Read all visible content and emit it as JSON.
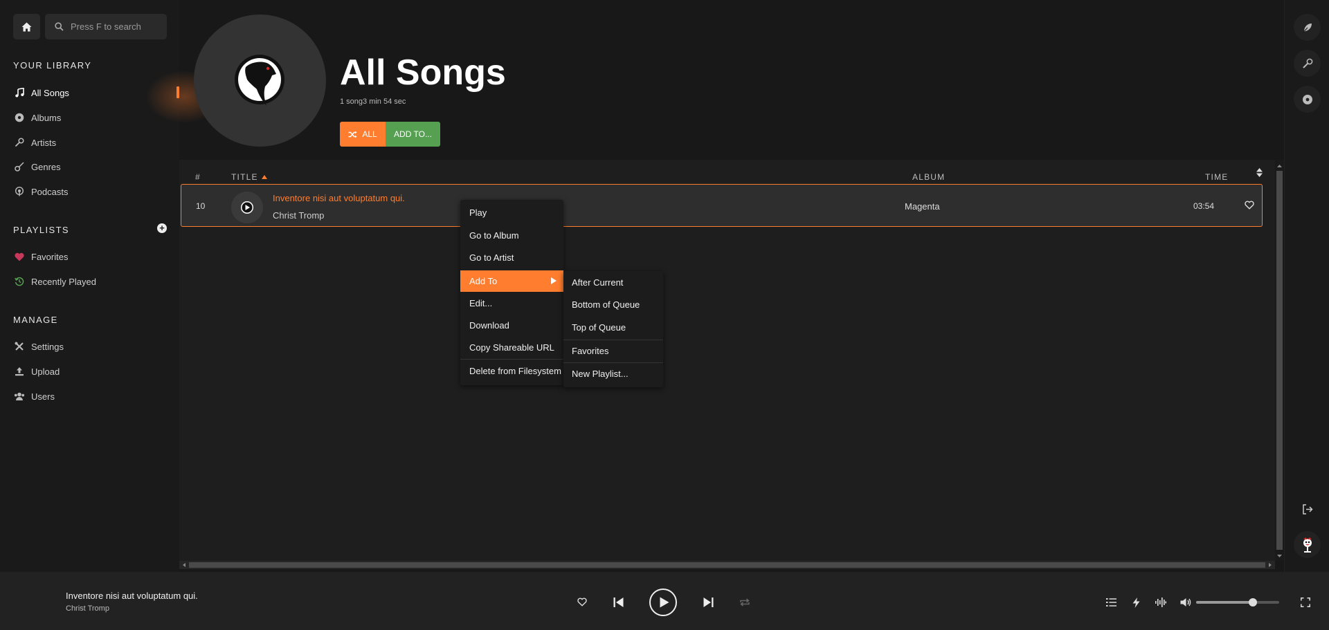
{
  "sidebar": {
    "search_placeholder": "Press F to search",
    "library_title": "YOUR LIBRARY",
    "library_items": [
      {
        "label": "All Songs",
        "icon": "music-note-icon"
      },
      {
        "label": "Albums",
        "icon": "disc-icon"
      },
      {
        "label": "Artists",
        "icon": "microphone-icon"
      },
      {
        "label": "Genres",
        "icon": "guitar-icon"
      },
      {
        "label": "Podcasts",
        "icon": "podcast-icon"
      }
    ],
    "playlists_title": "PLAYLISTS",
    "playlist_items": [
      {
        "label": "Favorites",
        "icon": "heart-icon"
      },
      {
        "label": "Recently Played",
        "icon": "history-icon"
      }
    ],
    "manage_title": "MANAGE",
    "manage_items": [
      {
        "label": "Settings",
        "icon": "tools-icon"
      },
      {
        "label": "Upload",
        "icon": "upload-icon"
      },
      {
        "label": "Users",
        "icon": "users-icon"
      }
    ]
  },
  "header": {
    "title": "All Songs",
    "meta": "1 song3 min 54 sec",
    "shuffle_label": "ALL",
    "add_to_label": "ADD TO..."
  },
  "table": {
    "col_num": "#",
    "col_title": "TITLE",
    "col_album": "ALBUM",
    "col_time": "TIME",
    "rows": [
      {
        "num": "10",
        "title": "Inventore nisi aut voluptatum qui.",
        "artist": "Christ Tromp",
        "album": "Magenta",
        "time": "03:54"
      }
    ]
  },
  "context_menu": {
    "items": [
      "Play",
      "Go to Album",
      "Go to Artist",
      "Add To",
      "Edit...",
      "Download",
      "Copy Shareable URL",
      "Delete from Filesystem"
    ],
    "submenu": [
      "After Current",
      "Bottom of Queue",
      "Top of Queue",
      "Favorites",
      "New Playlist..."
    ]
  },
  "player": {
    "title": "Inventore nisi aut voluptatum qui.",
    "artist": "Christ Tromp",
    "volume": 0.68
  },
  "colors": {
    "accent": "#ff7d2e",
    "green": "#56a052",
    "favorite": "#c8385a",
    "recent": "#56a052"
  }
}
